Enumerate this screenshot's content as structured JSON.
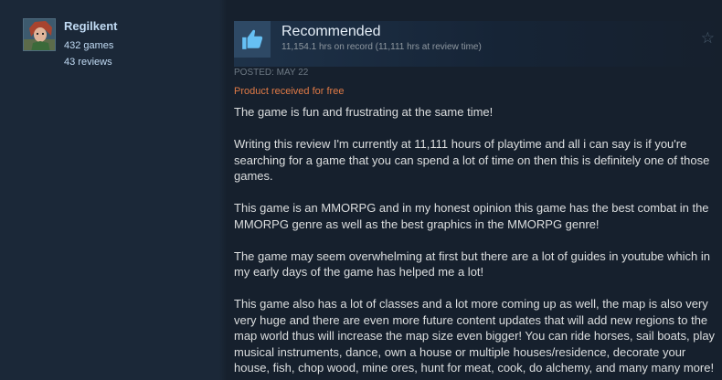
{
  "author": {
    "name": "Regilkent",
    "games": "432 games",
    "reviews": "43 reviews"
  },
  "review": {
    "verdict": "Recommended",
    "hours": "11,154.1 hrs on record (11,111 hrs at review time)",
    "posted": "POSTED: MAY 22",
    "free_note": "Product received for free",
    "paragraphs": [
      "The game is fun and frustrating at the same time!",
      "Writing this review I'm currently at 11,111 hours of playtime and all i can say is if you're searching for a game that you can spend a lot of time on then this is definitely one of those games.",
      "This game is an MMORPG and in my honest opinion this game has the best combat in the MMORPG genre as well as the best graphics in the MMORPG genre!",
      "The game may seem overwhelming at first but there are a lot of guides in youtube which in my early days of the game has helped me a lot!",
      "This game also has a lot of classes and a lot more coming up as well, the map is also very very huge and there are even more future content updates that will add new regions to the map world thus will increase the map size even bigger! You can ride horses, sail boats, play musical instruments, dance, own a house or multiple houses/residence, decorate your house, fish, chop wood, mine ores, hunt for meat, cook, do alchemy, and many many more!"
    ]
  },
  "icons": {
    "thumb": "thumbs-up-icon",
    "star": "star-outline-icon"
  },
  "colors": {
    "background": "#1b2838",
    "panel": "#16202d",
    "free_note": "#e07a46",
    "link": "#c1dbf4"
  }
}
